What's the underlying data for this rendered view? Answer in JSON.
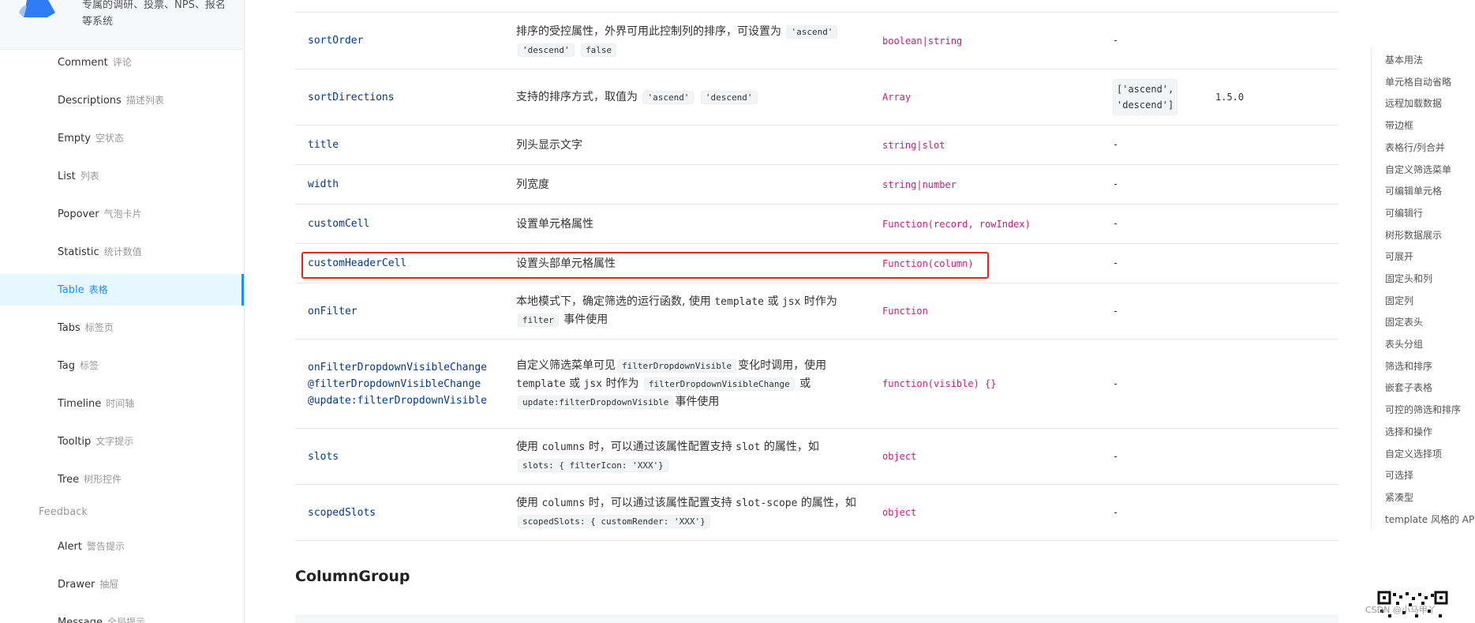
{
  "sidebar": {
    "promo_text": "专属的调研、投票、NPS、报名等系统",
    "items": [
      {
        "en": "Comment",
        "zh": "评论"
      },
      {
        "en": "Descriptions",
        "zh": "描述列表"
      },
      {
        "en": "Empty",
        "zh": "空状态"
      },
      {
        "en": "List",
        "zh": "列表"
      },
      {
        "en": "Popover",
        "zh": "气泡卡片"
      },
      {
        "en": "Statistic",
        "zh": "统计数值"
      },
      {
        "en": "Table",
        "zh": "表格"
      },
      {
        "en": "Tabs",
        "zh": "标签页"
      },
      {
        "en": "Tag",
        "zh": "标签"
      },
      {
        "en": "Timeline",
        "zh": "时间轴"
      },
      {
        "en": "Tooltip",
        "zh": "文字提示"
      },
      {
        "en": "Tree",
        "zh": "树形控件"
      }
    ],
    "group_feedback": "Feedback",
    "feedback_items": [
      {
        "en": "Alert",
        "zh": "警告提示"
      },
      {
        "en": "Drawer",
        "zh": "抽屉"
      },
      {
        "en": "Message",
        "zh": "全局提示"
      }
    ],
    "active": "Table",
    "accent": "#1890ff"
  },
  "table": {
    "rows": [
      {
        "prop": "sortOrder",
        "desc_pre": "排序的受控属性，外界可用此控制列的排序，可设置为",
        "codes": [
          "'ascend'",
          "'descend'",
          "false"
        ],
        "type": "boolean|string",
        "default": "-",
        "version": ""
      },
      {
        "prop": "sortDirections",
        "desc_pre": "支持的排序方式，取值为",
        "codes": [
          "'ascend'",
          "'descend'"
        ],
        "type": "Array",
        "default_line1": "['ascend',",
        "default_line2": "'descend']",
        "version": "1.5.0"
      },
      {
        "prop": "title",
        "desc": "列头显示文字",
        "type": "string|slot",
        "default": "-"
      },
      {
        "prop": "width",
        "desc": "列宽度",
        "type": "string|number",
        "default": "-"
      },
      {
        "prop": "customCell",
        "desc": "设置单元格属性",
        "type": "Function(record, rowIndex)",
        "default": "-"
      },
      {
        "prop": "customHeaderCell",
        "desc": "设置头部单元格属性",
        "type": "Function(column)",
        "default": "-"
      },
      {
        "prop": "onFilter",
        "desc_a": "本地模式下，确定筛选的运行函数, 使用",
        "m1": "template",
        "desc_b": "或",
        "m2": "jsx",
        "desc_c": "时作为",
        "code": "filter",
        "desc_d": "事件使用",
        "type": "Function",
        "default": "-"
      },
      {
        "prop_l1": "onFilterDropdownVisibleChange",
        "prop_l2": "@filterDropdownVisibleChange",
        "prop_l3": "@update:filterDropdownVisible",
        "desc_a": "自定义筛选菜单可见",
        "code1": "filterDropdownVisible",
        "desc_b": "变化时调用，使用",
        "m1": "template",
        "desc_c": "或",
        "m2": "jsx",
        "desc_d": "时作为",
        "code2": "filterDropdownVisibleChange",
        "desc_e": "或",
        "code3": "update:filterDropdownVisible",
        "desc_f": "事件使用",
        "type": "function(visible) {}",
        "default": "-"
      },
      {
        "prop": "slots",
        "desc_a": "使用",
        "m1": "columns",
        "desc_b": "时，可以通过该属性配置支持",
        "m2": "slot",
        "desc_c": "的属性，如",
        "code": "slots: { filterIcon: 'XXX'}",
        "type": "object",
        "default": "-"
      },
      {
        "prop": "scopedSlots",
        "desc_a": "使用",
        "m1": "columns",
        "desc_b": "时，可以通过该属性配置支持",
        "m2": "slot-scope",
        "desc_c": "的属性，如",
        "code": "scopedSlots: { customRender: 'XXX'}",
        "type": "object",
        "default": "-"
      }
    ]
  },
  "section_title": "ColumnGroup",
  "anchor": {
    "items": [
      "基本用法",
      "单元格自动省略",
      "远程加载数据",
      "带边框",
      "表格行/列合并",
      "自定义筛选菜单",
      "可编辑单元格",
      "可编辑行",
      "树形数据展示",
      "可展开",
      "固定头和列",
      "固定列",
      "固定表头",
      "表头分组",
      "筛选和排序",
      "嵌套子表格",
      "可控的筛选和排序",
      "选择和操作",
      "自定义选择项",
      "可选择",
      "紧凑型",
      "template 风格的 API"
    ]
  },
  "watermark": "CSDN @小马甲丫",
  "highlight_color": "#e0261b"
}
